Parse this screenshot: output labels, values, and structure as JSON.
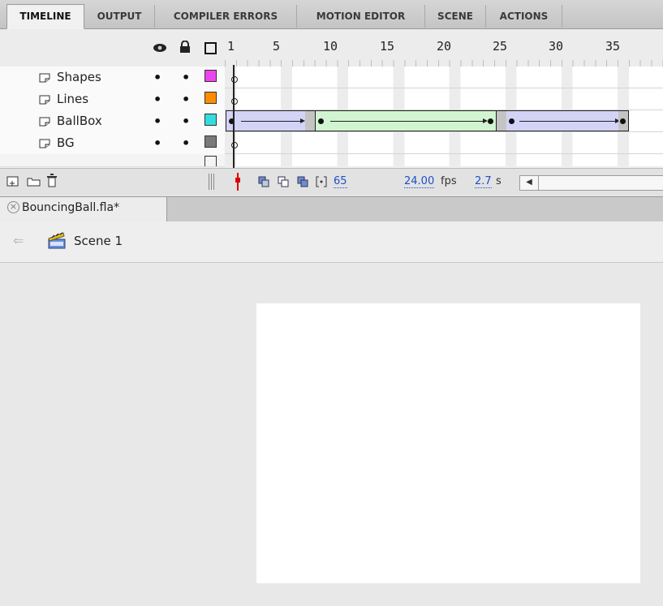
{
  "tabs": [
    "TIMELINE",
    "OUTPUT",
    "COMPILER ERRORS",
    "MOTION EDITOR",
    "SCENE",
    "ACTIONS"
  ],
  "ruler": [
    "1",
    "5",
    "10",
    "15",
    "20",
    "25",
    "30",
    "35"
  ],
  "layers": [
    {
      "name": "Shapes",
      "color": "#ee44ee"
    },
    {
      "name": "Lines",
      "color": "#ff8c00"
    },
    {
      "name": "BallBox",
      "color": "#33dddd"
    },
    {
      "name": "BG",
      "color": "#7a7a7a"
    }
  ],
  "status": {
    "current_frame": "65",
    "fps": "24.00",
    "fps_unit": "fps",
    "time": "2.7",
    "time_unit": "s"
  },
  "document": {
    "tab_label": "BouncingBall.fla*",
    "close_glyph": "×"
  },
  "scene": {
    "label": "Scene 1"
  },
  "icons": {
    "eye": "eye-icon",
    "lock": "lock-icon",
    "outline": "outline-icon",
    "layer": "layer-icon",
    "new_layer": "new-layer-icon",
    "new_folder": "new-folder-icon",
    "delete": "trash-icon",
    "clapper": "clapperboard-icon",
    "back": "back-arrow-icon"
  },
  "colors": {
    "tween_blue": "#d3d3f7",
    "tween_green": "#d1f5d1",
    "stage": "#ffffff",
    "link": "#1e4fc6"
  }
}
